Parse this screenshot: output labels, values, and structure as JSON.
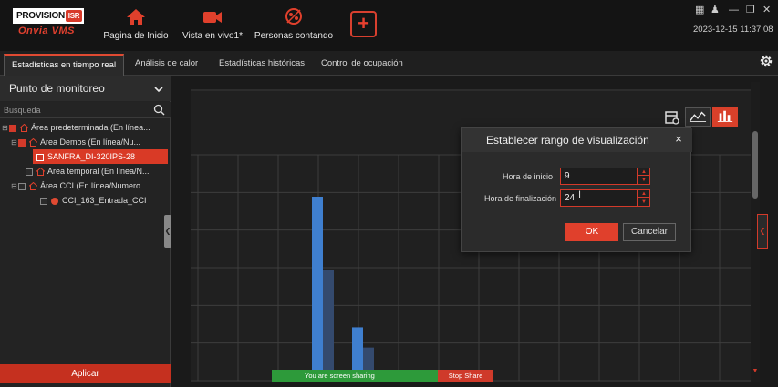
{
  "brand": {
    "logo_text": "PROVISION",
    "logo_badge": "ISR",
    "logo_sub": "Onvia VMS"
  },
  "nav": [
    {
      "label": "Pagina de Inicio",
      "icon": "home-icon"
    },
    {
      "label": "Vista en vivo1*",
      "icon": "camera-icon"
    },
    {
      "label": "Personas contando",
      "icon": "people-counting-icon"
    }
  ],
  "add_button": "+",
  "window_controls": {
    "grid": "▦",
    "user": "♟",
    "minimize": "—",
    "restore": "❐",
    "close": "✕"
  },
  "datetime": "2023-12-15 11:37:08",
  "tabs": [
    {
      "label": "Estadísticas en tiempo real",
      "active": true
    },
    {
      "label": "Análisis de calor",
      "active": false
    },
    {
      "label": "Estadísticas históricas",
      "active": false
    },
    {
      "label": "Control de ocupación",
      "active": false
    }
  ],
  "left_panel": {
    "header": "Punto de monitoreo",
    "search_placeholder": "Busqueda",
    "tree": [
      {
        "label": "Área predeterminada (En línea...",
        "level": 0,
        "checked": true,
        "type": "area",
        "expander": "⊟"
      },
      {
        "label": "Area Demos (En línea/Nu...",
        "level": 1,
        "checked": true,
        "type": "area",
        "expander": "⊟"
      },
      {
        "label": "SANFRA_DI-320IPS-28",
        "level": 2,
        "checked": true,
        "type": "device",
        "selected": true,
        "expander": ""
      },
      {
        "label": "Area temporal (En línea/N...",
        "level": 1,
        "checked": false,
        "type": "area",
        "expander": ""
      },
      {
        "label": "Área CCI (En línea/Numero...",
        "level": 1,
        "checked": false,
        "type": "area",
        "expander": "⊟"
      },
      {
        "label": "CCI_163_Entrada_CCI",
        "level": 2,
        "checked": false,
        "type": "camera",
        "expander": ""
      }
    ],
    "apply_label": "Aplicar"
  },
  "chart_data": {
    "type": "bar",
    "series": [
      {
        "color": "#3f7fcf",
        "values": [
          0,
          0,
          1.0,
          0.29,
          0,
          0,
          0,
          0,
          0,
          0,
          0,
          0,
          0,
          0
        ]
      },
      {
        "color": "#344a6e",
        "values": [
          0,
          0,
          0.6,
          0.18,
          0,
          0,
          0,
          0,
          0,
          0,
          0,
          0,
          0,
          0
        ]
      }
    ],
    "grid": true
  },
  "dialog": {
    "title": "Establecer rango de visualización",
    "close": "×",
    "start_label": "Hora de inicio",
    "start_value": "9",
    "end_label": "Hora de finalización",
    "end_value": "24",
    "ok_label": "OK",
    "cancel_label": "Cancelar"
  },
  "sharing": {
    "message": "You are screen sharing",
    "stop_label": "Stop Share"
  },
  "colors": {
    "accent": "#e0402c",
    "bar_primary": "#3f7fcf",
    "bar_secondary": "#344a6e",
    "share_green": "#2d9a3a"
  }
}
